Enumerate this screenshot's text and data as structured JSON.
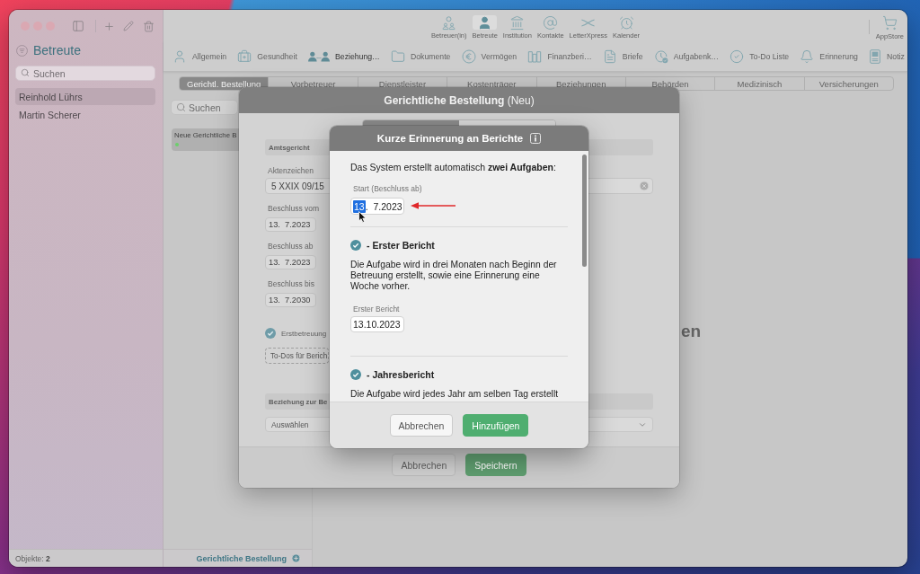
{
  "sidebar": {
    "title": "Betreute",
    "search": {
      "placeholder": "Suchen"
    },
    "items": [
      {
        "label": "Reinhold Lührs",
        "selected": true
      },
      {
        "label": "Martin Scherer",
        "selected": false
      }
    ],
    "status": "Objekte: **2**"
  },
  "toolbar": {
    "items": [
      {
        "label": "Betreuer(in)",
        "selected": false
      },
      {
        "label": "Betreute",
        "selected": true
      },
      {
        "label": "Institution",
        "selected": false
      },
      {
        "label": "Kontakte",
        "selected": false
      },
      {
        "label": "LetterXpress",
        "selected": false
      },
      {
        "label": "Kalender",
        "selected": false
      }
    ],
    "store": {
      "label": "AppStore"
    }
  },
  "section_bar": {
    "items": [
      {
        "label": "Allgemein",
        "selected": false
      },
      {
        "label": "Gesundheit",
        "selected": false
      },
      {
        "label": "Beziehung…",
        "selected": true
      },
      {
        "label": "Dokumente",
        "selected": false
      },
      {
        "label": "Vermögen",
        "selected": false
      },
      {
        "label": "Finanzberi…",
        "selected": false
      },
      {
        "label": "Briefe",
        "selected": false
      },
      {
        "label": "Aufgabenk…",
        "selected": false
      },
      {
        "label": "To-Do Liste",
        "selected": false
      },
      {
        "label": "Erinnerung",
        "selected": false
      },
      {
        "label": "Notiz",
        "selected": false
      }
    ]
  },
  "tabs": [
    {
      "label": "Gerichtl. Bestellung",
      "selected": true
    },
    {
      "label": "Vorbetreuer",
      "selected": false
    },
    {
      "label": "Dienstleister",
      "selected": false
    },
    {
      "label": "Kostenträger",
      "selected": false
    },
    {
      "label": "Beziehungen",
      "selected": false
    },
    {
      "label": "Behörden",
      "selected": false
    },
    {
      "label": "Medizinisch",
      "selected": false
    },
    {
      "label": "Versicherungen",
      "selected": false
    }
  ],
  "list": {
    "search": {
      "placeholder": "Suchen"
    },
    "items": [
      {
        "label": "Neue Gerichtliche B",
        "selected": true,
        "color": "#6ccf6c"
      }
    ],
    "add_button": "Gerichtliche Bestellung"
  },
  "empty_hint": "en",
  "sheet": {
    "title": "**Gerichtliche Bestellung** (Neu)",
    "segments": [
      {
        "selected": true
      },
      {
        "selected": false
      }
    ],
    "court": {
      "title": "Amtsgericht"
    },
    "fields": [
      {
        "kind": "text",
        "label": "Aktenzeichen",
        "value": "5 XXIX 09/15"
      },
      {
        "kind": "date",
        "label": "Beschluss vom",
        "value": "13.  7.2023"
      },
      {
        "kind": "date",
        "label": "Beschluss ab",
        "value": "13.  7.2023"
      },
      {
        "kind": "date",
        "label": "Beschluss bis",
        "value": "13.  7.2030"
      }
    ],
    "first_care": {
      "label": "Erstbetreuung",
      "checked": true
    },
    "todo_button": "To-Dos für Berich",
    "relation": {
      "title": "Beziehung zur Be",
      "select": "Auswählen"
    },
    "buttons": [
      {
        "label": "Abbrechen",
        "kind": "secondary"
      },
      {
        "label": "Speichern",
        "kind": "primary"
      }
    ]
  },
  "dialog": {
    "title": "Kurze Erinnerung an Berichte",
    "intro": "Das System erstellt automatisch **zwei Aufgaben**:",
    "start": {
      "label": "Start (Beschluss ab)",
      "day": "13",
      "rest": ".  7.2023",
      "day_selected": true
    },
    "tasks": [
      {
        "title": "- Erster Bericht",
        "checked": true,
        "text": "Die Aufgabe wird in drei Monaten nach Beginn der Betreuung erstellt, sowie eine Erinnerung eine Woche vorher.",
        "date": {
          "label": "Erster Bericht",
          "value": "13.10.2023"
        }
      },
      {
        "title": "- Jahresbericht",
        "checked": true,
        "text": "Die Aufgabe wird jedes Jahr am selben Tag erstellt"
      }
    ],
    "buttons": [
      {
        "label": "Abbrechen",
        "kind": "secondary"
      },
      {
        "label": "Hinzufügen",
        "kind": "primary"
      }
    ]
  }
}
